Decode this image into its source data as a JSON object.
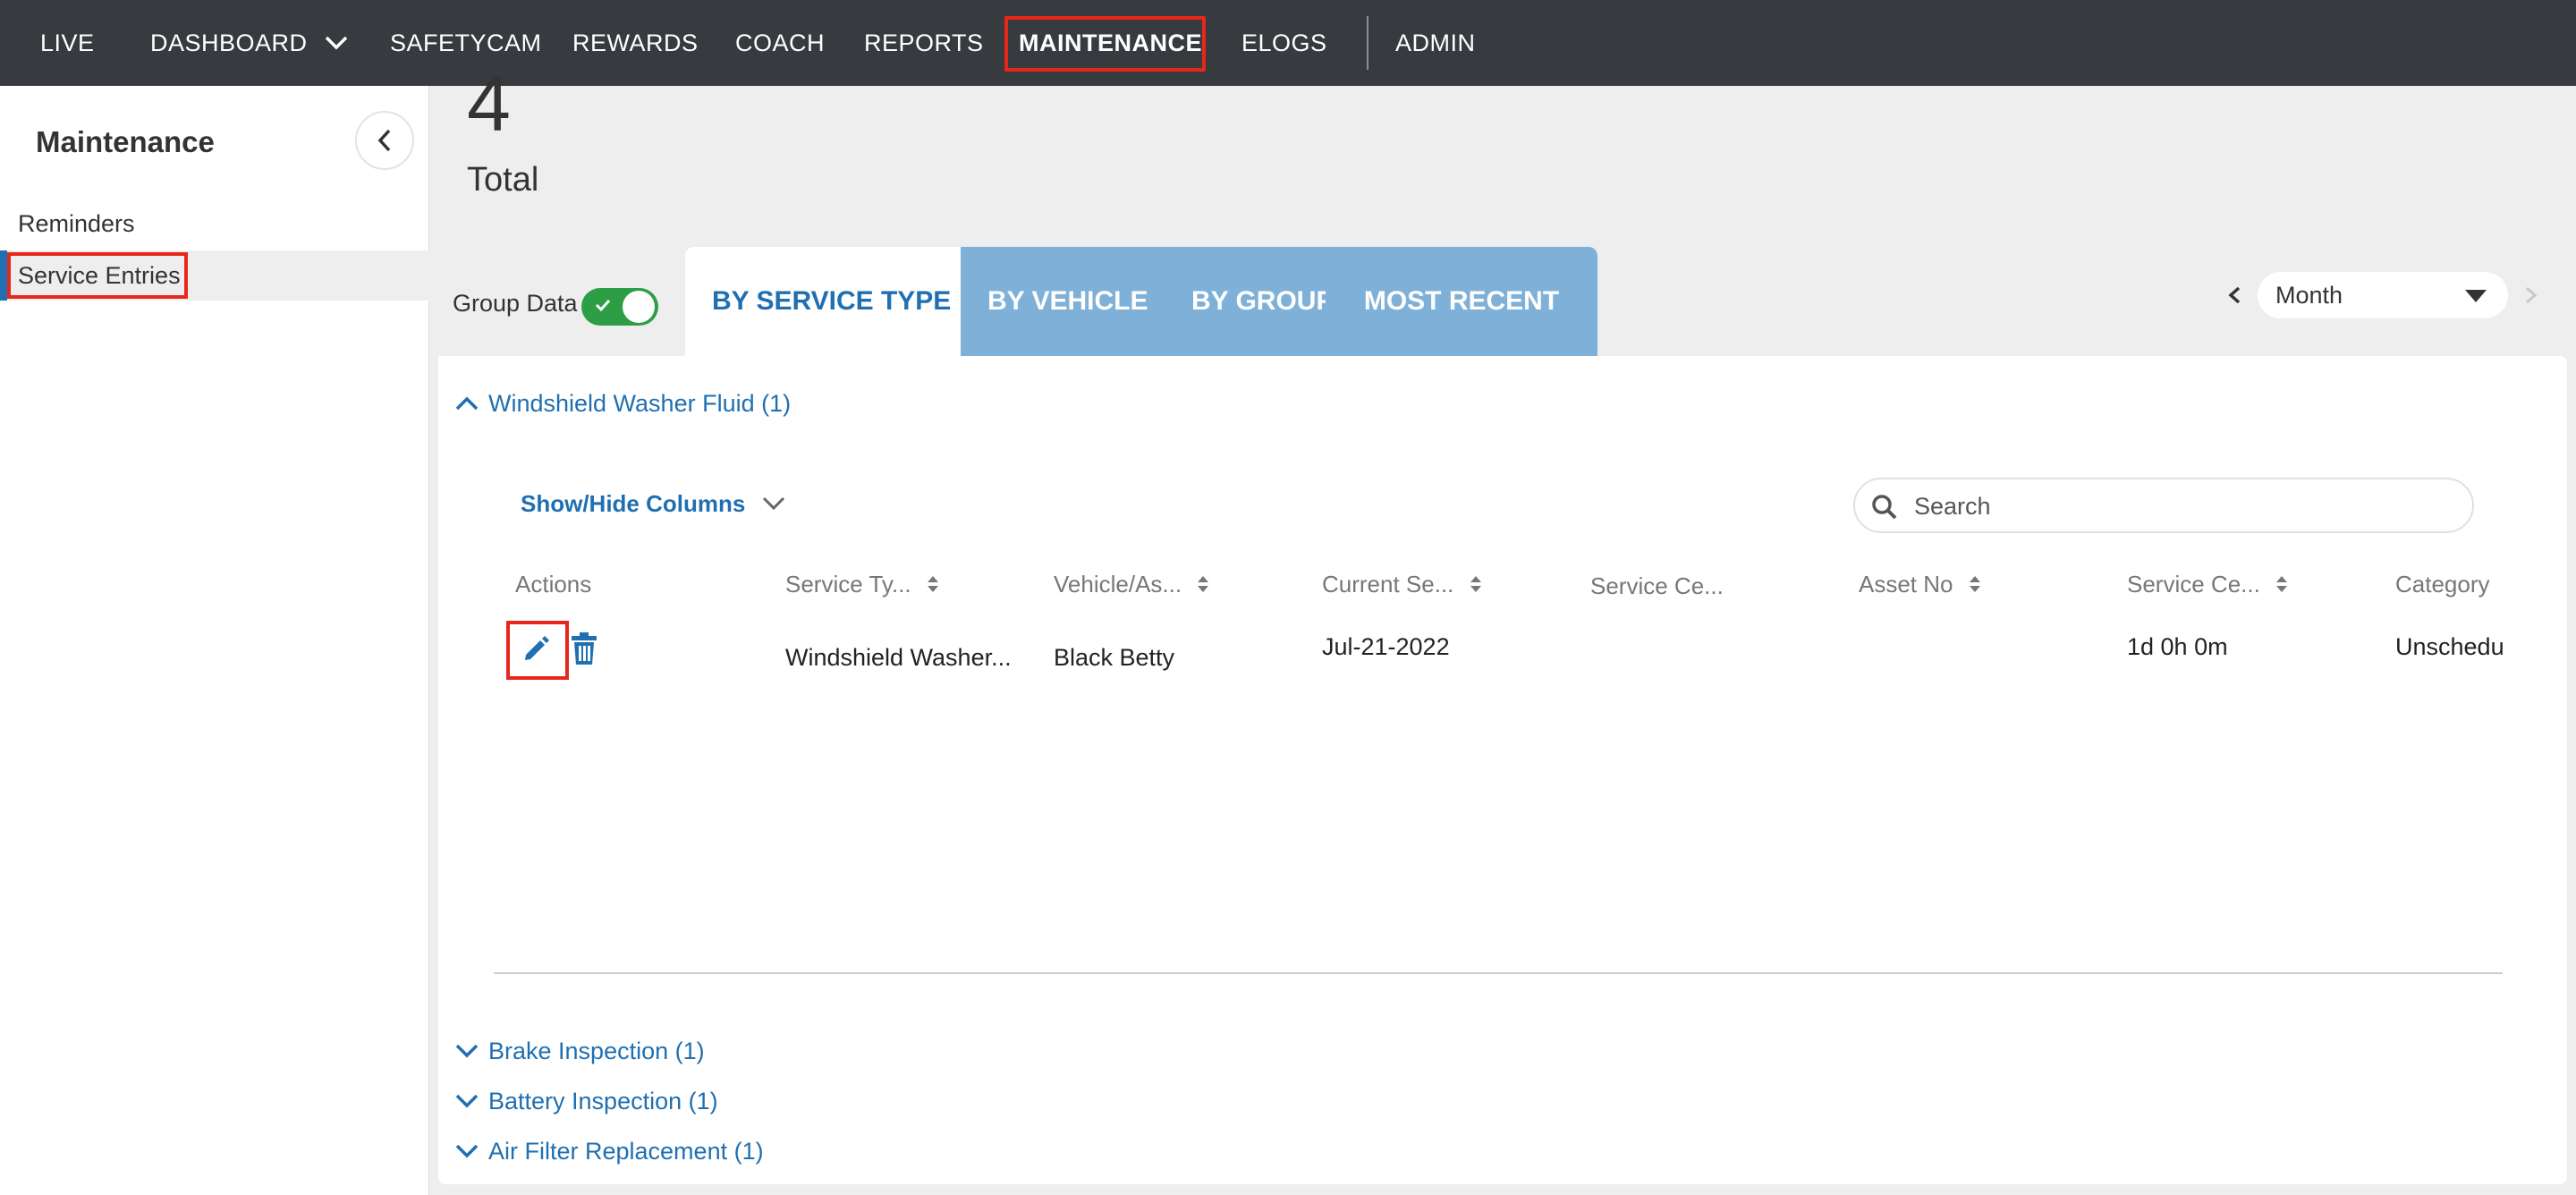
{
  "nav": {
    "items": [
      {
        "label": "LIVE"
      },
      {
        "label": "DASHBOARD"
      },
      {
        "label": "SAFETYCAM"
      },
      {
        "label": "REWARDS"
      },
      {
        "label": "COACH"
      },
      {
        "label": "REPORTS"
      },
      {
        "label": "MAINTENANCE",
        "active": true
      },
      {
        "label": "ELOGS"
      },
      {
        "label": "ADMIN"
      }
    ]
  },
  "sidebar": {
    "title": "Maintenance",
    "items": [
      {
        "label": "Reminders"
      },
      {
        "label": "Service Entries",
        "active": true
      }
    ]
  },
  "summary": {
    "total_value": "4",
    "total_label": "Total"
  },
  "group_data": {
    "label": "Group Data",
    "enabled": true
  },
  "tabs": [
    {
      "label": "BY SERVICE TYPE",
      "active": true
    },
    {
      "label": "BY VEHICLE"
    },
    {
      "label": "BY GROUP"
    },
    {
      "label": "MOST RECENT"
    }
  ],
  "period": {
    "selected": "Month"
  },
  "groups": [
    {
      "label": "Windshield Washer Fluid (1)",
      "expanded": true
    },
    {
      "label": "Brake Inspection (1)",
      "expanded": false
    },
    {
      "label": "Battery Inspection (1)",
      "expanded": false
    },
    {
      "label": "Air Filter Replacement (1)",
      "expanded": false
    }
  ],
  "table": {
    "show_hide_label": "Show/Hide Columns",
    "search_placeholder": "Search",
    "columns": [
      "Actions",
      "Service Ty...",
      "Vehicle/As...",
      "Current Se...",
      "Service Ce...",
      "Asset No",
      "Service Ce...",
      "Category"
    ],
    "rows": [
      {
        "service_type": "Windshield Washer...",
        "vehicle": "Black Betty",
        "current_service": "Jul-21-2022",
        "service_center": "",
        "asset_no": "",
        "service_cost_time": "1d 0h 0m",
        "category": "Unschedu"
      }
    ]
  },
  "colors": {
    "nav_bg": "#373a3e",
    "accent_blue": "#1f6fb2",
    "tab_inactive": "#7fb1d8",
    "toggle_on": "#2e9e46",
    "highlight_red": "#e8271b"
  },
  "icons": {
    "edit": "pencil-icon",
    "delete": "trash-icon",
    "search": "search-icon",
    "collapse": "chevron-left-icon"
  }
}
